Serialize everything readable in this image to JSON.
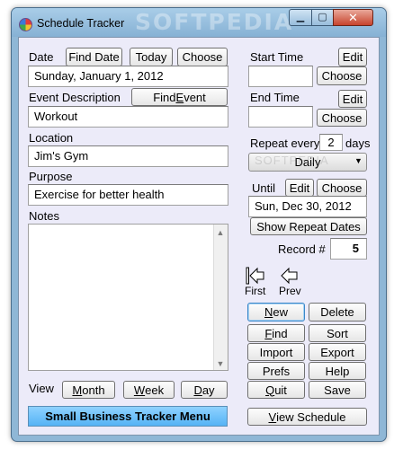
{
  "window": {
    "title": "Schedule Tracker",
    "watermark": "SOFTPEDIA",
    "minimize_glyph": "▁",
    "maximize_glyph": "▢",
    "close_glyph": "✕"
  },
  "date": {
    "label": "Date",
    "find_button": "Find Date",
    "today_button": "Today",
    "choose_button": "Choose",
    "value": "Sunday, January 1, 2012"
  },
  "event": {
    "label": "Event Description",
    "find_button_pre": "Find ",
    "find_button_u": "E",
    "find_button_post": "vent",
    "value": "Workout"
  },
  "location": {
    "label": "Location",
    "value": "Jim's Gym"
  },
  "purpose": {
    "label": "Purpose",
    "value": "Exercise for better health"
  },
  "notes": {
    "label": "Notes",
    "value": ""
  },
  "view": {
    "label": "View",
    "month_u": "M",
    "month_rest": "onth",
    "week_u": "W",
    "week_rest": "eek",
    "day_u": "D",
    "day_rest": "ay"
  },
  "menu_button": "Small Business Tracker Menu",
  "start_time": {
    "label": "Start Time",
    "edit_button": "Edit",
    "choose_button": "Choose",
    "value": ""
  },
  "end_time": {
    "label": "End Time",
    "edit_button": "Edit",
    "choose_button": "Choose",
    "value": ""
  },
  "repeat": {
    "label": "Repeat every",
    "value": "2",
    "unit": "days",
    "frequency": "Daily",
    "frequency_watermark": "SOFTPEDIA"
  },
  "until": {
    "label": "Until",
    "edit_button": "Edit",
    "choose_button": "Choose",
    "value": "Sun, Dec 30, 2012",
    "show_button": "Show Repeat Dates"
  },
  "record": {
    "label": "Record #",
    "value": "5"
  },
  "nav": {
    "first": "First",
    "prev": "Prev"
  },
  "actions": {
    "new_u": "N",
    "new_rest": "ew",
    "delete": "Delete",
    "find_u": "F",
    "find_rest": "ind",
    "sort": "Sort",
    "import": "Import",
    "export": "Export",
    "prefs": "Prefs",
    "help": "Help",
    "quit_u": "Q",
    "quit_rest": "uit",
    "save": "Save",
    "view_schedule_u": "V",
    "view_schedule_rest": "iew Schedule"
  },
  "colors": {
    "client_bg": "#ecebf9",
    "menu_button": "#6fc2fb",
    "window_frame": "#8fb7d6"
  }
}
